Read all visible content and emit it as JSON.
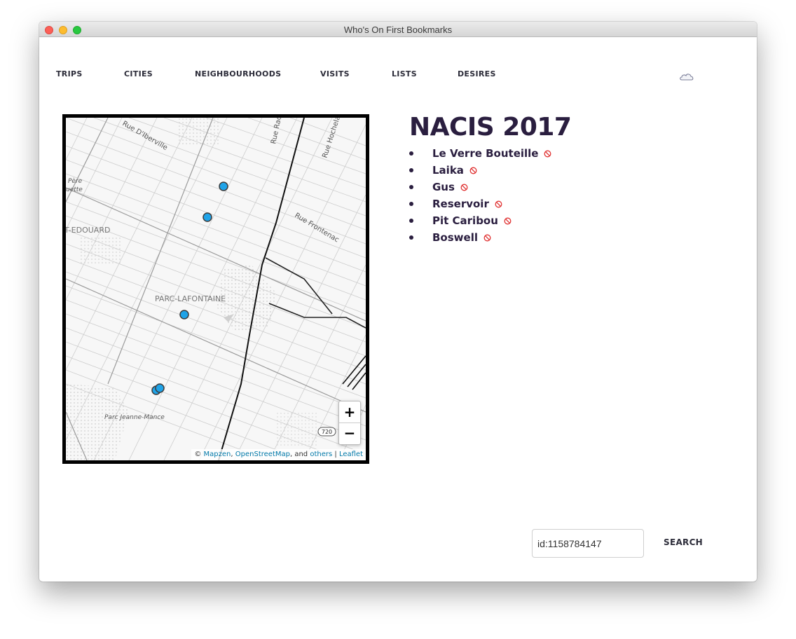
{
  "window": {
    "title": "Who's On First Bookmarks"
  },
  "nav": {
    "items": [
      {
        "label": "TRIPS"
      },
      {
        "label": "CITIES"
      },
      {
        "label": "NEIGHBOURHOODS"
      },
      {
        "label": "VISITS"
      },
      {
        "label": "LISTS"
      },
      {
        "label": "DESIRES"
      }
    ],
    "account_icon": "cloud-icon"
  },
  "page": {
    "title": "NACIS 2017"
  },
  "places": [
    {
      "name": "Le Verre Bouteille",
      "remove_icon": "no-entry-icon"
    },
    {
      "name": "Laika",
      "remove_icon": "no-entry-icon"
    },
    {
      "name": "Gus",
      "remove_icon": "no-entry-icon"
    },
    {
      "name": "Reservoir",
      "remove_icon": "no-entry-icon"
    },
    {
      "name": "Pit Caribou",
      "remove_icon": "no-entry-icon"
    },
    {
      "name": "Boswell",
      "remove_icon": "no-entry-icon"
    }
  ],
  "map": {
    "labels": {
      "street_iberville": "Rue D'Iberville",
      "street_rachel": "Rue Rach",
      "street_hochelaga": "Rue Hochelag",
      "street_frontenac": "Rue Frontenac",
      "pere_1": "Père",
      "pere_2": "uette",
      "st_edouard": "T-EDOUARD",
      "parc_lafontaine": "PARC-LAFONTAINE",
      "parc_jeanne_mance": "Parc Jeanne-Mance",
      "highway_shield": "720"
    },
    "zoom_in": "+",
    "zoom_out": "−",
    "attribution": {
      "prefix": "©",
      "mapzen": "Mapzen",
      "sep1": ",",
      "osm": "OpenStreetMap",
      "and": ", and",
      "others": "others",
      "bar": "|",
      "leaflet": "Leaflet"
    },
    "marker_color": "#1fa3e8"
  },
  "search": {
    "value": "id:1158784147",
    "button_label": "SEARCH"
  },
  "colors": {
    "title": "#2a1e3f",
    "remove_icon": "#e03131",
    "link": "#0078a8"
  }
}
